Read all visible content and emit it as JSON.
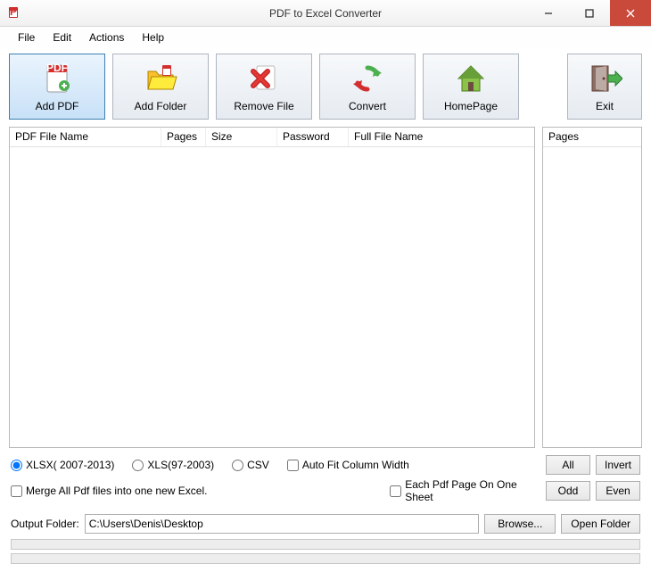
{
  "window": {
    "title": "PDF to Excel Converter"
  },
  "menu": {
    "file": "File",
    "edit": "Edit",
    "actions": "Actions",
    "help": "Help"
  },
  "toolbar": {
    "add_pdf": "Add PDF",
    "add_folder": "Add Folder",
    "remove_file": "Remove File",
    "convert": "Convert",
    "homepage": "HomePage",
    "exit": "Exit"
  },
  "columns": {
    "pdf_file_name": "PDF File Name",
    "pages": "Pages",
    "size": "Size",
    "password": "Password",
    "full_file_name": "Full File Name",
    "side_pages": "Pages"
  },
  "options": {
    "xlsx": "XLSX( 2007-2013)",
    "xls": "XLS(97-2003)",
    "csv": "CSV",
    "autofit": "Auto Fit Column Width",
    "merge": "Merge All Pdf files into one new Excel.",
    "each_sheet": "Each Pdf Page On One Sheet"
  },
  "side_buttons": {
    "all": "All",
    "invert": "Invert",
    "odd": "Odd",
    "even": "Even"
  },
  "output": {
    "label": "Output Folder:",
    "value": "C:\\Users\\Denis\\Desktop",
    "browse": "Browse...",
    "open_folder": "Open Folder"
  }
}
